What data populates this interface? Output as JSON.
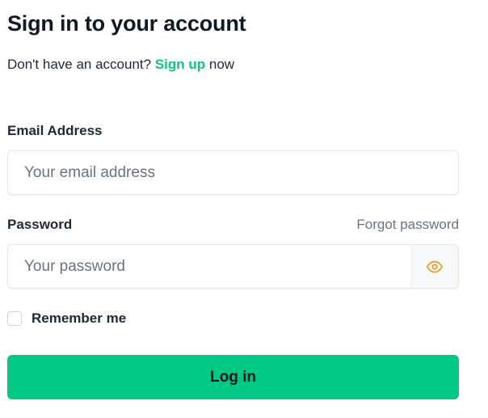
{
  "heading": "Sign in to your account",
  "signup": {
    "prompt": "Don't have an account?",
    "link_label": "Sign up",
    "suffix": "now"
  },
  "email": {
    "label": "Email Address",
    "placeholder": "Your email address",
    "value": ""
  },
  "password": {
    "label": "Password",
    "placeholder": "Your password",
    "value": "",
    "forgot_label": "Forgot password",
    "toggle_icon": "eye-icon"
  },
  "remember": {
    "label": "Remember me",
    "checked": false
  },
  "submit": {
    "label": "Log in"
  },
  "colors": {
    "accent": "#10c27c",
    "button": "#00c986",
    "eye_icon": "#e2a32a"
  }
}
